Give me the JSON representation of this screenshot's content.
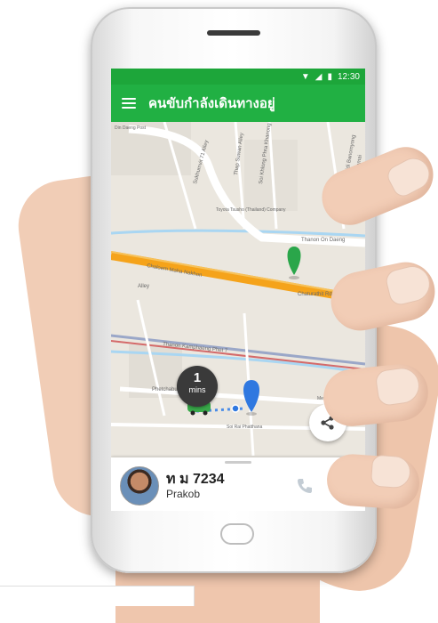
{
  "status_bar": {
    "time": "12:30"
  },
  "app_bar": {
    "title": "คนขับกำลังเดินทางอยู่"
  },
  "map": {
    "labels": {
      "sukhumvit": "Sukhumvit 71 Alley",
      "thap_suwan": "Thap Suwan Alley",
      "soi_khlong": "Soi Khlong Phra Khanong",
      "pridi": "Soi Pridi Banomyong",
      "ekkamai": "Ekkamai",
      "toyota": "Toyota Tsusho (Thailand) Company",
      "thanon_on_daeng": "Thanon On Daeng",
      "chaluemlarp": "Chaloem Maha Nakhon",
      "chalerm_rd": "Chaturathit Rd",
      "alley": "Alley",
      "kamphaeng": "Thanon Kamphaeng Phet 7",
      "phetchaburi": "Phetchaburi",
      "rai_pattana": "Soi Rai Phatthana",
      "metro": "Metro Club",
      "top_left": "Din Daeng Post"
    }
  },
  "eta": {
    "value": "1",
    "unit": "mins"
  },
  "driver": {
    "plate": "ท ม 7234",
    "name": "Prakob"
  },
  "icons": {
    "share": "share-icon",
    "phone": "phone-icon",
    "mail": "mail-icon",
    "menu": "menu-icon"
  },
  "colors": {
    "primary": "#21b043",
    "status": "#1da63a",
    "expressway": "#f5a31a",
    "marker_green": "#2aa64a",
    "marker_blue": "#2f78e0"
  }
}
